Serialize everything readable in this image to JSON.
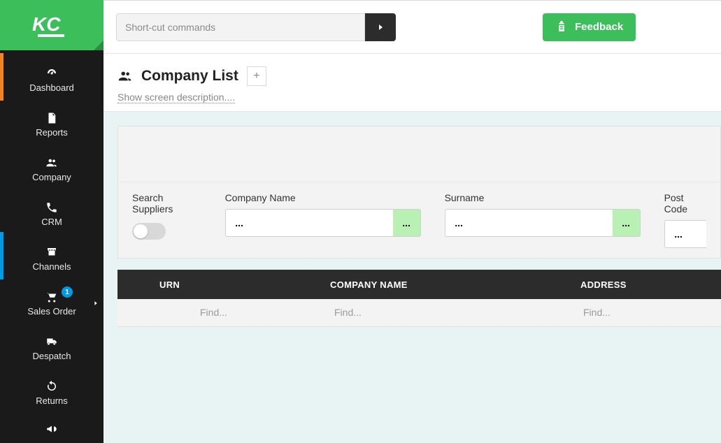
{
  "header": {
    "shortcut_placeholder": "Short-cut commands",
    "feedback_label": "Feedback"
  },
  "sidebar": {
    "items": [
      {
        "label": "Dashboard"
      },
      {
        "label": "Reports"
      },
      {
        "label": "Company"
      },
      {
        "label": "CRM"
      },
      {
        "label": "Channels"
      },
      {
        "label": "Sales Order",
        "badge": "1"
      },
      {
        "label": "Despatch"
      },
      {
        "label": "Returns"
      }
    ]
  },
  "page": {
    "title": "Company List",
    "description_link": "Show screen description....",
    "add_label": "+"
  },
  "filters": {
    "search_suppliers_label": "Search Suppliers",
    "company_name_label": "Company Name",
    "surname_label": "Surname",
    "postcode_label": "Post Code",
    "pre_text": "...",
    "post_text": "..."
  },
  "table": {
    "headers": {
      "urn": "URN",
      "company": "COMPANY NAME",
      "address": "ADDRESS"
    },
    "find_placeholder": "Find..."
  }
}
